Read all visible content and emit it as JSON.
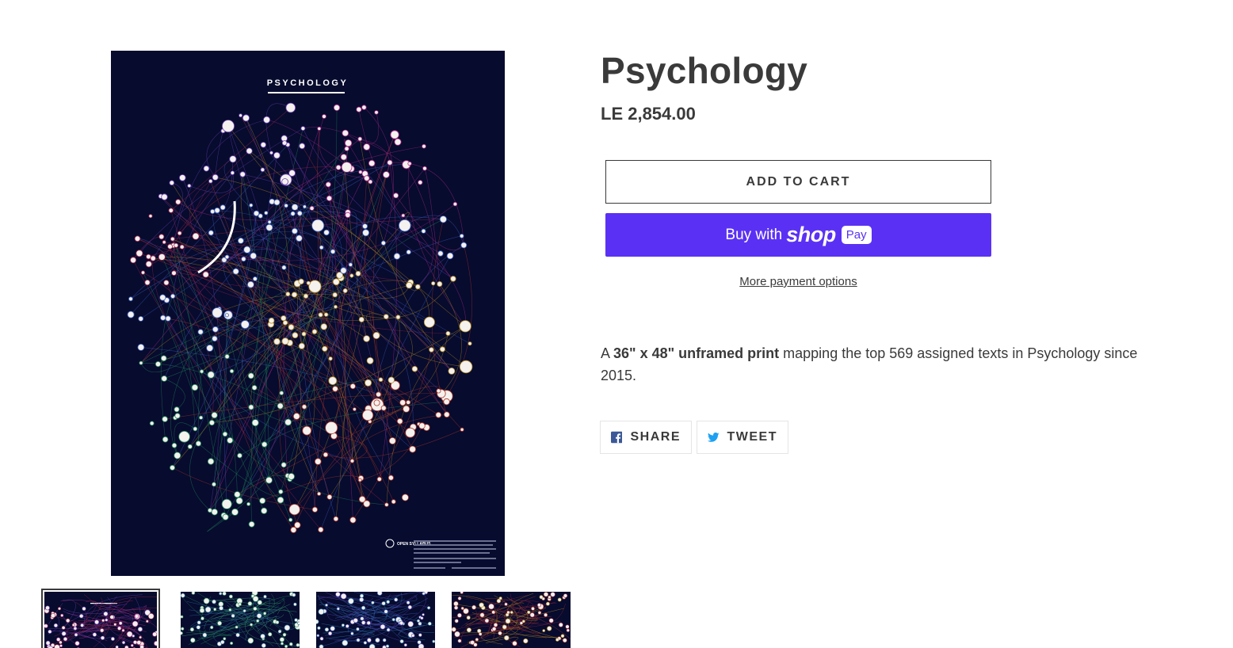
{
  "product": {
    "title": "Psychology",
    "price": "LE 2,854.00"
  },
  "poster": {
    "heading": "PSYCHOLOGY",
    "logo_text": "OPEN SYLLABUS"
  },
  "buttons": {
    "add_to_cart": "ADD TO CART",
    "buy_with": "Buy with",
    "shop_word": "shop",
    "pay_badge": "Pay",
    "more_payment_options": "More payment options"
  },
  "description": {
    "prefix": "A ",
    "bold": "36\" x 48\" unframed print",
    "suffix": " mapping the top 569 assigned texts in Psychology since 2015."
  },
  "social": {
    "share_label": "SHARE",
    "tweet_label": "TWEET",
    "facebook_icon": "facebook-icon",
    "twitter_icon": "twitter-icon"
  },
  "thumbnails": [
    {
      "name": "poster-full",
      "hue": "mixed"
    },
    {
      "name": "detail-green",
      "hue": "green"
    },
    {
      "name": "detail-blue",
      "hue": "blue"
    },
    {
      "name": "detail-red",
      "hue": "red"
    }
  ],
  "colors": {
    "accent_shop_pay": "#5a31f4",
    "text": "#3a3a3a",
    "poster_bg": "#070b2e",
    "twitter_blue": "#1da1f2",
    "facebook_blue": "#3b5998"
  }
}
